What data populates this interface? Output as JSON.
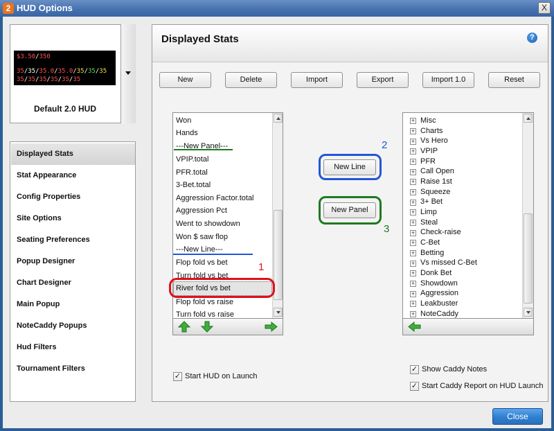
{
  "window": {
    "title": "HUD Options",
    "app_icon": "2",
    "close_glyph": "X"
  },
  "hud_selector": {
    "name": "Default 2.0 HUD",
    "preview": {
      "line1": "$3.50",
      "line1_sep": "/",
      "line1_b": "350",
      "line2": [
        "35",
        "35",
        "35.0",
        "35.0",
        "35",
        "35",
        "35"
      ],
      "line3": [
        "35",
        "35",
        "35",
        "35",
        "35",
        "35"
      ]
    }
  },
  "sidebar": {
    "items": [
      {
        "label": "Displayed Stats",
        "active": true
      },
      {
        "label": "Stat Appearance"
      },
      {
        "label": "Config Properties"
      },
      {
        "label": "Site Options"
      },
      {
        "label": "Seating Preferences"
      },
      {
        "label": "Popup Designer"
      },
      {
        "label": "Chart Designer"
      },
      {
        "label": "Main Popup"
      },
      {
        "label": "NoteCaddy Popups"
      },
      {
        "label": "Hud Filters"
      },
      {
        "label": "Tournament Filters"
      }
    ]
  },
  "main": {
    "title": "Displayed Stats",
    "help_glyph": "?",
    "toolbar": [
      "New",
      "Delete",
      "Import",
      "Export",
      "Import 1.0",
      "Reset"
    ],
    "stats_list": [
      "Won",
      "Hands",
      "---New Panel---",
      "VPIP.total",
      "PFR.total",
      "3-Bet.total",
      "Aggression Factor.total",
      "Aggression Pct",
      "Went to showdown",
      "Won $ saw flop",
      "---New Line---",
      "Flop fold vs bet",
      "Turn fold vs bet",
      "River fold vs bet",
      "Flop fold vs raise",
      "Turn fold vs raise"
    ],
    "selected_stat": "River fold vs bet",
    "buttons": {
      "new_line": "New Line",
      "new_panel": "New Panel"
    },
    "categories": [
      "Misc",
      "Charts",
      "Vs Hero",
      "VPIP",
      "PFR",
      "Call Open",
      "Raise 1st",
      "Squeeze",
      "3+ Bet",
      "Limp",
      "Steal",
      "Check-raise",
      "C-Bet",
      "Betting",
      "Vs missed C-Bet",
      "Donk Bet",
      "Showdown",
      "Aggression",
      "Leakbuster",
      "NoteCaddy"
    ],
    "annotations": {
      "n1": "1",
      "n2": "2",
      "n3": "3"
    },
    "checkboxes": {
      "start_hud": {
        "label": "Start HUD on Launch",
        "checked": true
      },
      "show_caddy_notes": {
        "label": "Show Caddy Notes",
        "checked": true
      },
      "start_caddy_report": {
        "label": "Start Caddy Report on HUD Launch",
        "checked": true
      }
    },
    "check_glyph": "✓",
    "close_button": "Close"
  },
  "colors": {
    "accent_blue": "#2255d8",
    "annotation_green": "#1e7a1e",
    "annotation_red": "#e0101a",
    "close_button": "#2f7fd0"
  }
}
